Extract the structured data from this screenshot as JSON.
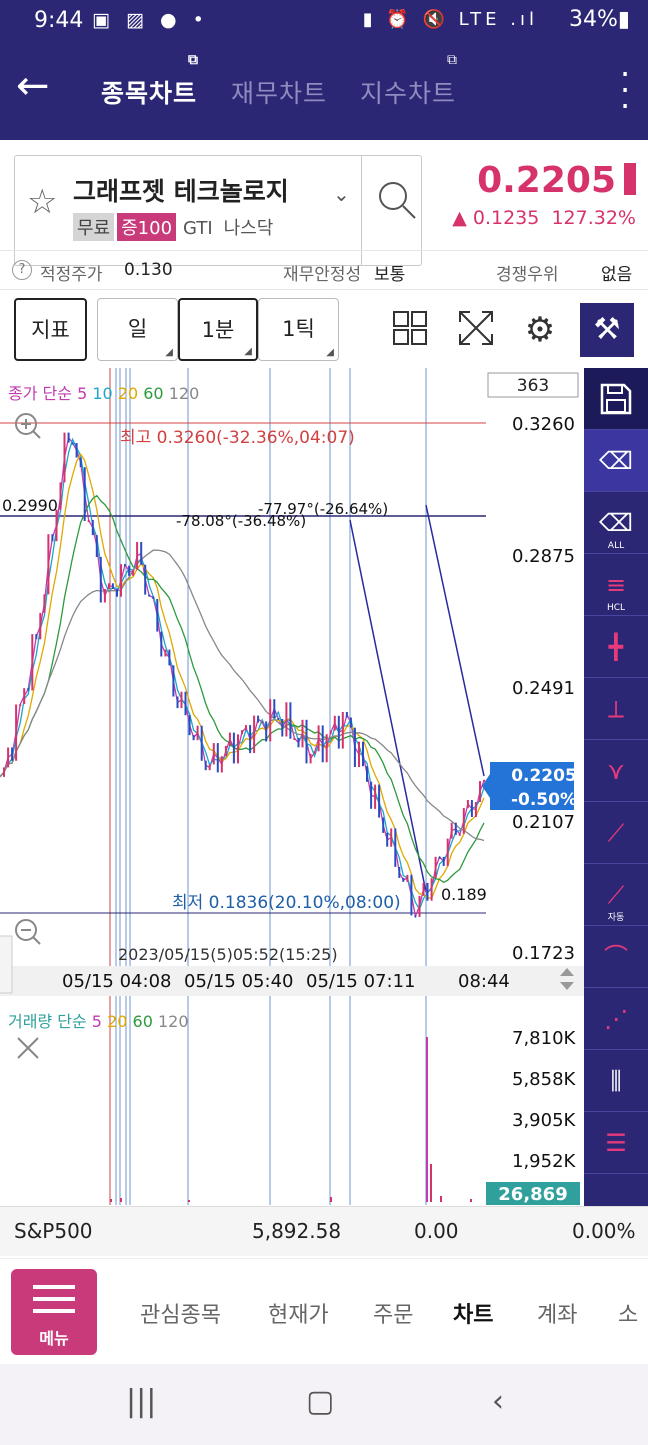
{
  "status_bar": {
    "time": "9:44",
    "left_icons": "▣ ▨ ● •",
    "right_icons": "▮ ⏰ 🔇 LTE .ıl",
    "battery": "34%▮"
  },
  "appbar": {
    "tabs": [
      "종목차트",
      "재무차트",
      "지수차트"
    ]
  },
  "stock": {
    "name": "그래프젯 테크놀로지",
    "tags": [
      "무료",
      "증100",
      "GTI",
      "나스닥"
    ],
    "price": "0.2205",
    "change": "▲ 0.1235",
    "change_pct": "127.32%"
  },
  "fair_value": {
    "label": "적정주가",
    "value": "0.130",
    "stability_label": "재무안정성",
    "stability_value": "보통",
    "competition_label": "경쟁우위",
    "competition_value": "없음"
  },
  "toolbar": {
    "indicator": "지표",
    "periods": [
      "일",
      "1분",
      "1틱"
    ]
  },
  "chart": {
    "ma_label": "종가 단순",
    "ma_periods": [
      "5",
      "10",
      "20",
      "60",
      "120"
    ],
    "ma_colors": [
      "#c23bb0",
      "#1ba6c9",
      "#e0a800",
      "#2d9a3c",
      "#888888"
    ],
    "count": "363",
    "high_label": "최고 0.3260(-32.36%,04:07)",
    "low_label": "최저 0.1836(20.10%,08:00)",
    "line_level": "0.2990",
    "angle1": "-77.97°(-26.64%)",
    "angle2": "-78.08°(-36.48%)",
    "y_ticks": [
      "0.3260",
      "0.2875",
      "0.2491",
      "0.2107",
      "0.1723"
    ],
    "current_price": "0.2205",
    "current_pct": "-0.50%",
    "partial_label": "0.189",
    "x_ticks": [
      "05/15 04:08",
      "05/15 05:40",
      "05/15 07:11",
      "08:44"
    ],
    "x_overlap": "2023/05/15(5)05:52(15:25)"
  },
  "volume": {
    "ma_label": "거래량 단순",
    "ma_periods": [
      "5",
      "20",
      "60",
      "120"
    ],
    "ma_colors": [
      "#c23bb0",
      "#e0a800",
      "#2d9a3c",
      "#888888"
    ],
    "y_ticks": [
      "7,810K",
      "5,858K",
      "3,905K",
      "1,952K"
    ],
    "current": "26,869"
  },
  "index_row": {
    "name": "S&P500",
    "value": "5,892.58",
    "change": "0.00",
    "pct": "0.00%"
  },
  "nav": {
    "menu": "메뉴",
    "items": [
      "관심종목",
      "현재가",
      "주문",
      "차트",
      "계좌",
      "소"
    ]
  },
  "side_tools": {
    "all": "ALL",
    "auto": "자동",
    "hcl": "HCL"
  },
  "chart_data": {
    "type": "line",
    "ylim": [
      0.1723,
      0.326
    ],
    "high": 0.326,
    "low": 0.1836,
    "current": 0.2205,
    "x": [
      "04:08",
      "05:40",
      "07:11",
      "08:44"
    ],
    "series": [
      {
        "name": "종가",
        "values": [
          0.22,
          0.261,
          0.326,
          0.275,
          0.2875,
          0.2491,
          0.226,
          0.235,
          0.241,
          0.23,
          0.24,
          0.2107,
          0.1836,
          0.205,
          0.2205
        ]
      }
    ]
  }
}
